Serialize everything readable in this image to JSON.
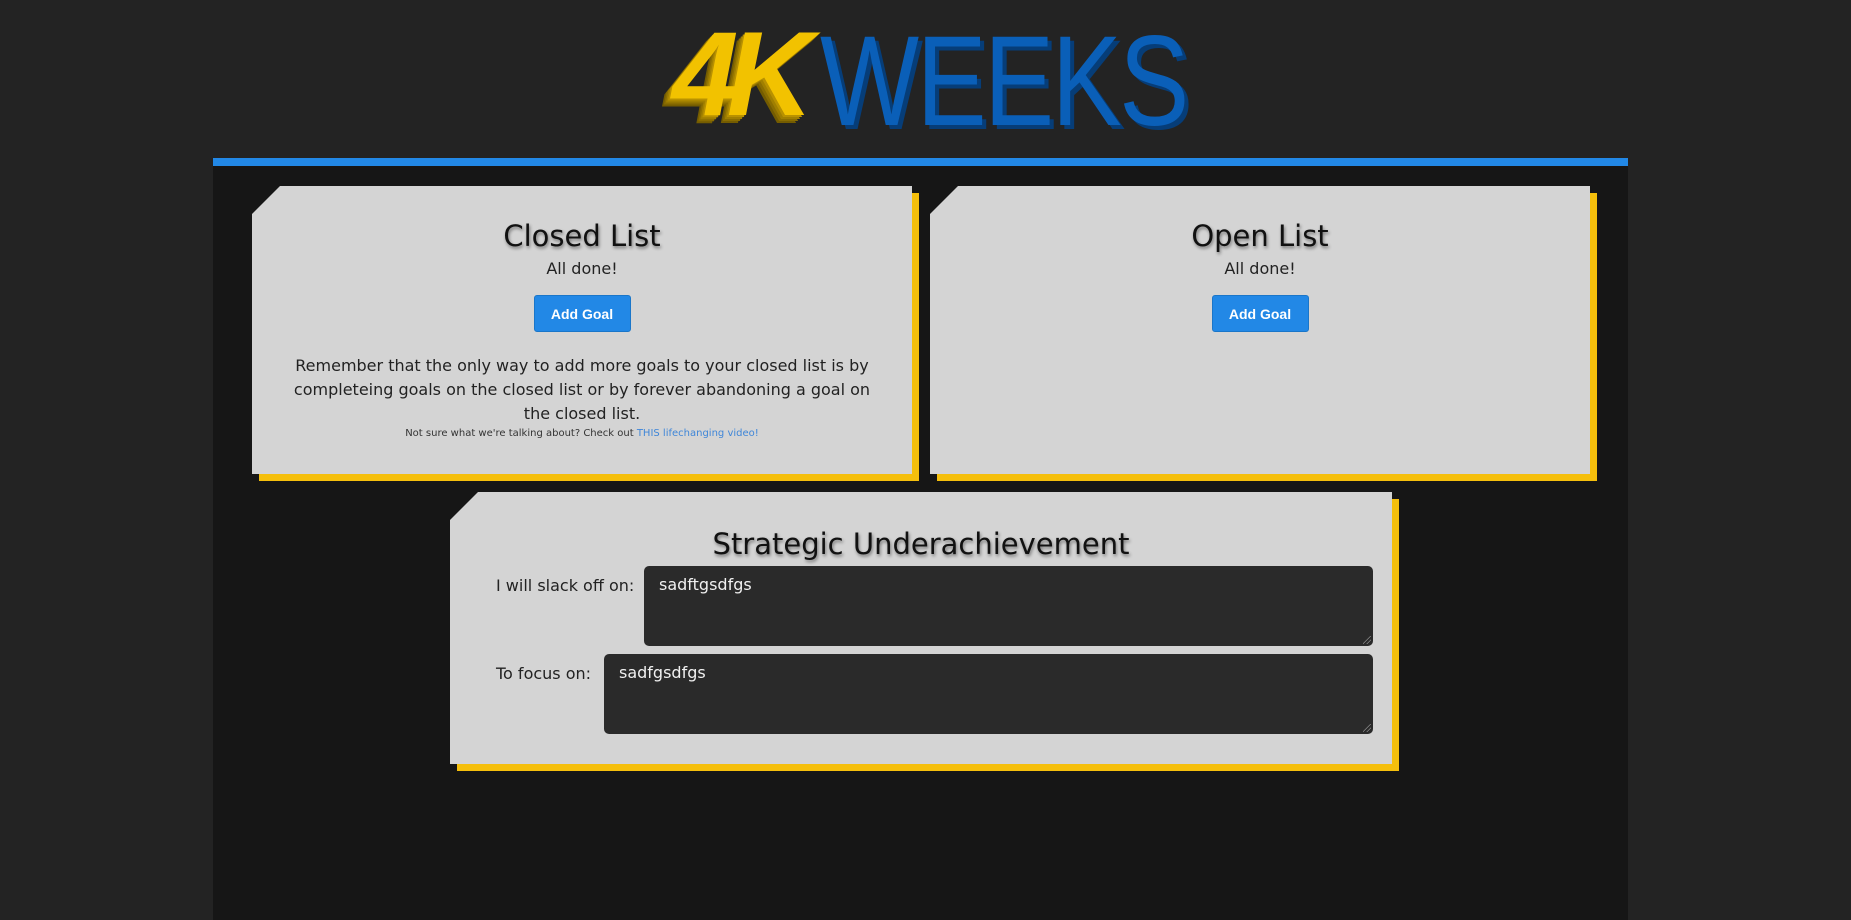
{
  "logo": {
    "part1": "4K",
    "part2": "WEEKS"
  },
  "closed_list": {
    "title": "Closed List",
    "status": "All done!",
    "add_label": "Add Goal",
    "reminder": "Remember that the only way to add more goals to your closed list is by completeing goals on the closed list or by forever abandoning a goal on the closed list.",
    "note_prefix": "Not sure what we're talking about? Check out ",
    "note_link": "THIS lifechanging video!"
  },
  "open_list": {
    "title": "Open List",
    "status": "All done!",
    "add_label": "Add Goal"
  },
  "strategic": {
    "title": "Strategic Underachievement",
    "slack_label": "I will slack off on:",
    "slack_value": "sadftgsdfgs",
    "focus_label": "To focus on:",
    "focus_value": "sadfgsdfgs"
  },
  "colors": {
    "accent_blue": "#2288e6",
    "accent_yellow": "#f5bf0c",
    "logo_blue": "#0a5fb8",
    "card_bg": "#d4d4d4"
  }
}
